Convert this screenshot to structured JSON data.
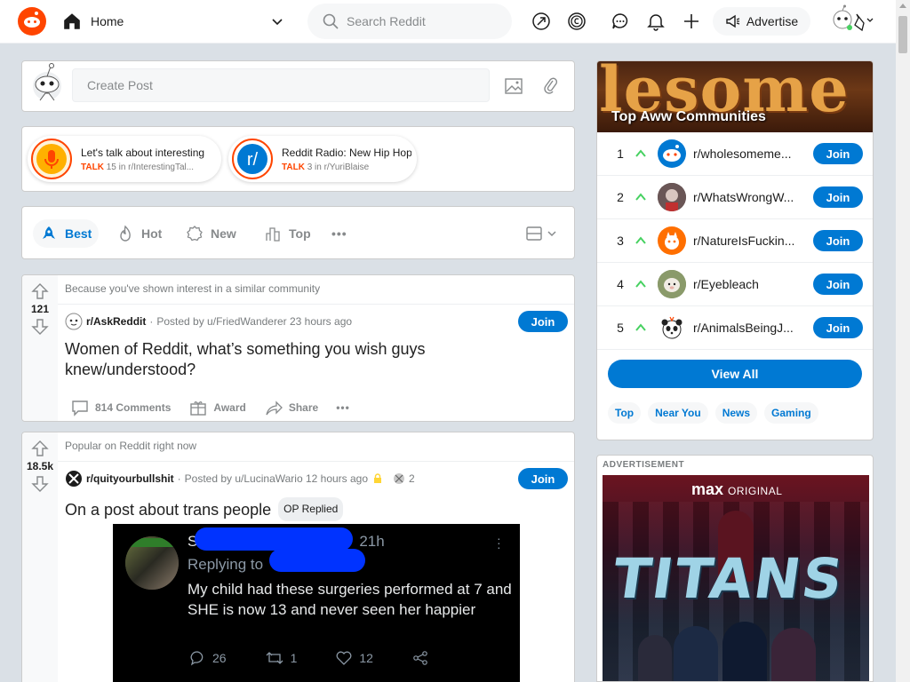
{
  "header": {
    "home_label": "Home",
    "search_placeholder": "Search Reddit",
    "advertise_label": "Advertise"
  },
  "create_post": {
    "placeholder": "Create Post"
  },
  "talks": [
    {
      "title": "Let's talk about interesting",
      "badge": "TALK",
      "meta": "15 in r/InterestingTal..."
    },
    {
      "title": "Reddit Radio: New Hip Hop",
      "badge": "TALK",
      "meta": "3 in r/YuriBlaise"
    }
  ],
  "sort": {
    "best": "Best",
    "hot": "Hot",
    "new": "New",
    "top": "Top"
  },
  "posts": [
    {
      "reason": "Because you've shown interest in a similar community",
      "votes": "121",
      "subreddit": "r/AskReddit",
      "posted_by": "Posted by u/FriedWanderer 23 hours ago",
      "join": "Join",
      "title": "Women of Reddit, what’s something you wish guys knew/understood?",
      "comments": "814 Comments",
      "award": "Award",
      "share": "Share"
    },
    {
      "reason": "Popular on Reddit right now",
      "votes": "18.5k",
      "subreddit": "r/quityourbullshit",
      "posted_by": "Posted by u/LucinaWario 12 hours ago",
      "award_count": "2",
      "join": "Join",
      "title": "On a post about trans people",
      "flair": "OP Replied",
      "tweet": {
        "name_suffix": "21h",
        "replying": "Replying to",
        "body": "My child had these surgeries performed at 7 and SHE is now 13 and never seen her happier",
        "replies": "26",
        "retweets": "1",
        "likes": "12"
      }
    }
  ],
  "communities": {
    "banner_text": "lesome Me",
    "title": "Top  Aww  Communities",
    "items": [
      {
        "rank": "1",
        "name": "r/wholesomeme...",
        "join": "Join"
      },
      {
        "rank": "2",
        "name": "r/WhatsWrongW...",
        "join": "Join"
      },
      {
        "rank": "3",
        "name": "r/NatureIsFuckin...",
        "join": "Join"
      },
      {
        "rank": "4",
        "name": "r/Eyebleach",
        "join": "Join"
      },
      {
        "rank": "5",
        "name": "r/AnimalsBeingJ...",
        "join": "Join"
      }
    ],
    "view_all": "View All",
    "tabs": [
      "Top",
      "Near You",
      "News",
      "Gaming"
    ]
  },
  "ad": {
    "label": "ADVERTISEMENT",
    "brand": "max",
    "brand_tag": "ORIGINAL",
    "title": "TITANS"
  },
  "colors": {
    "brand": "#ff4500",
    "accent": "#0079d3",
    "upvote": "#46d160"
  }
}
